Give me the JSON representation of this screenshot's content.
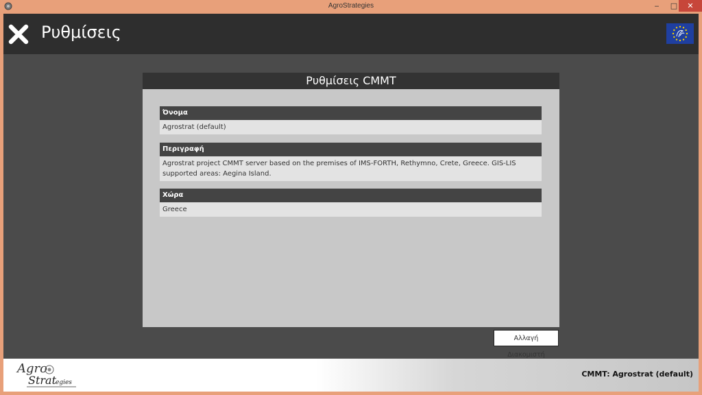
{
  "window": {
    "title": "AgroStrategies",
    "minimize_glyph": "‒",
    "maximize_glyph": "□",
    "close_glyph": "✕"
  },
  "header": {
    "title": "Ρυθμίσεις",
    "close_icon": "close-x-icon",
    "flag_icon": "eu-flag-icon"
  },
  "panel": {
    "title": "Ρυθμίσεις CMMT",
    "fields": [
      {
        "label": "Όνομα",
        "value": "Agrostrat (default)"
      },
      {
        "label": "Περιγραφή",
        "value": "Agrostrat project CMMT server based on the premises of IMS-FORTH, Rethymno, Crete, Greece. GIS-LIS supported areas: Aegina Island."
      },
      {
        "label": "Χώρα",
        "value": "Greece"
      }
    ]
  },
  "actions": {
    "change_server": "Αλλαγή Διακομιστή"
  },
  "footer": {
    "logo_top": "Agro",
    "logo_bottom": "Strat",
    "logo_suffix": "egies",
    "status": "CMMT: Agrostrat (default)"
  },
  "colors": {
    "window_frame": "#e8a07a",
    "header_bg": "#2e2e2e",
    "client_bg": "#4b4b4b",
    "panel_bg": "#c8c8c8",
    "flag_blue": "#1f3fa0",
    "flag_stars": "#f5d000"
  }
}
